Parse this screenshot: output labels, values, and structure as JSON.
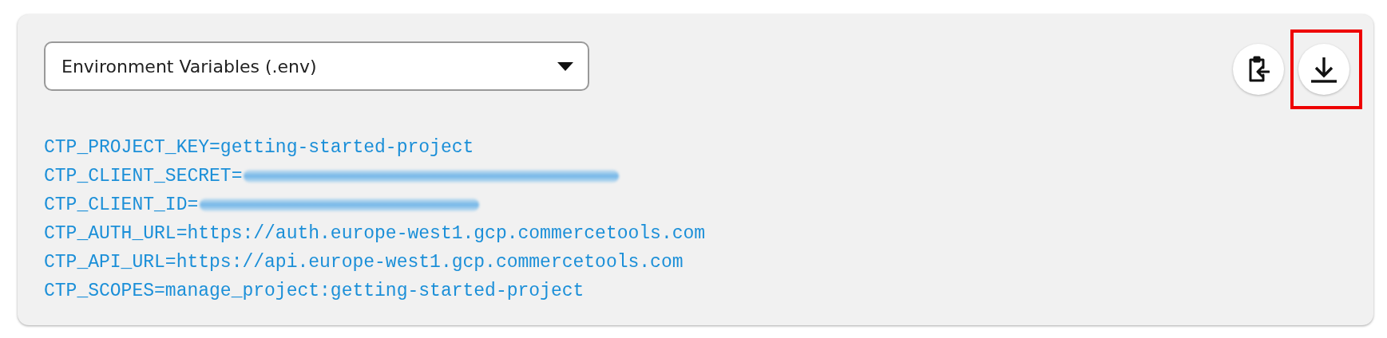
{
  "format_select": {
    "value": "Environment Variables (.env)"
  },
  "actions": [
    {
      "kind": "copy",
      "highlighted": false
    },
    {
      "kind": "download",
      "highlighted": true
    }
  ],
  "env_lines": [
    {
      "text": "CTP_PROJECT_KEY=getting-started-project",
      "redacted": false
    },
    {
      "text": "CTP_CLIENT_SECRET=",
      "redacted": true
    },
    {
      "text": "CTP_CLIENT_ID=",
      "redacted": true
    },
    {
      "text": "CTP_AUTH_URL=https://auth.europe-west1.gcp.commercetools.com",
      "redacted": false
    },
    {
      "text": "CTP_API_URL=https://api.europe-west1.gcp.commercetools.com",
      "redacted": false
    },
    {
      "text": "CTP_SCOPES=manage_project:getting-started-project",
      "redacted": false
    }
  ]
}
